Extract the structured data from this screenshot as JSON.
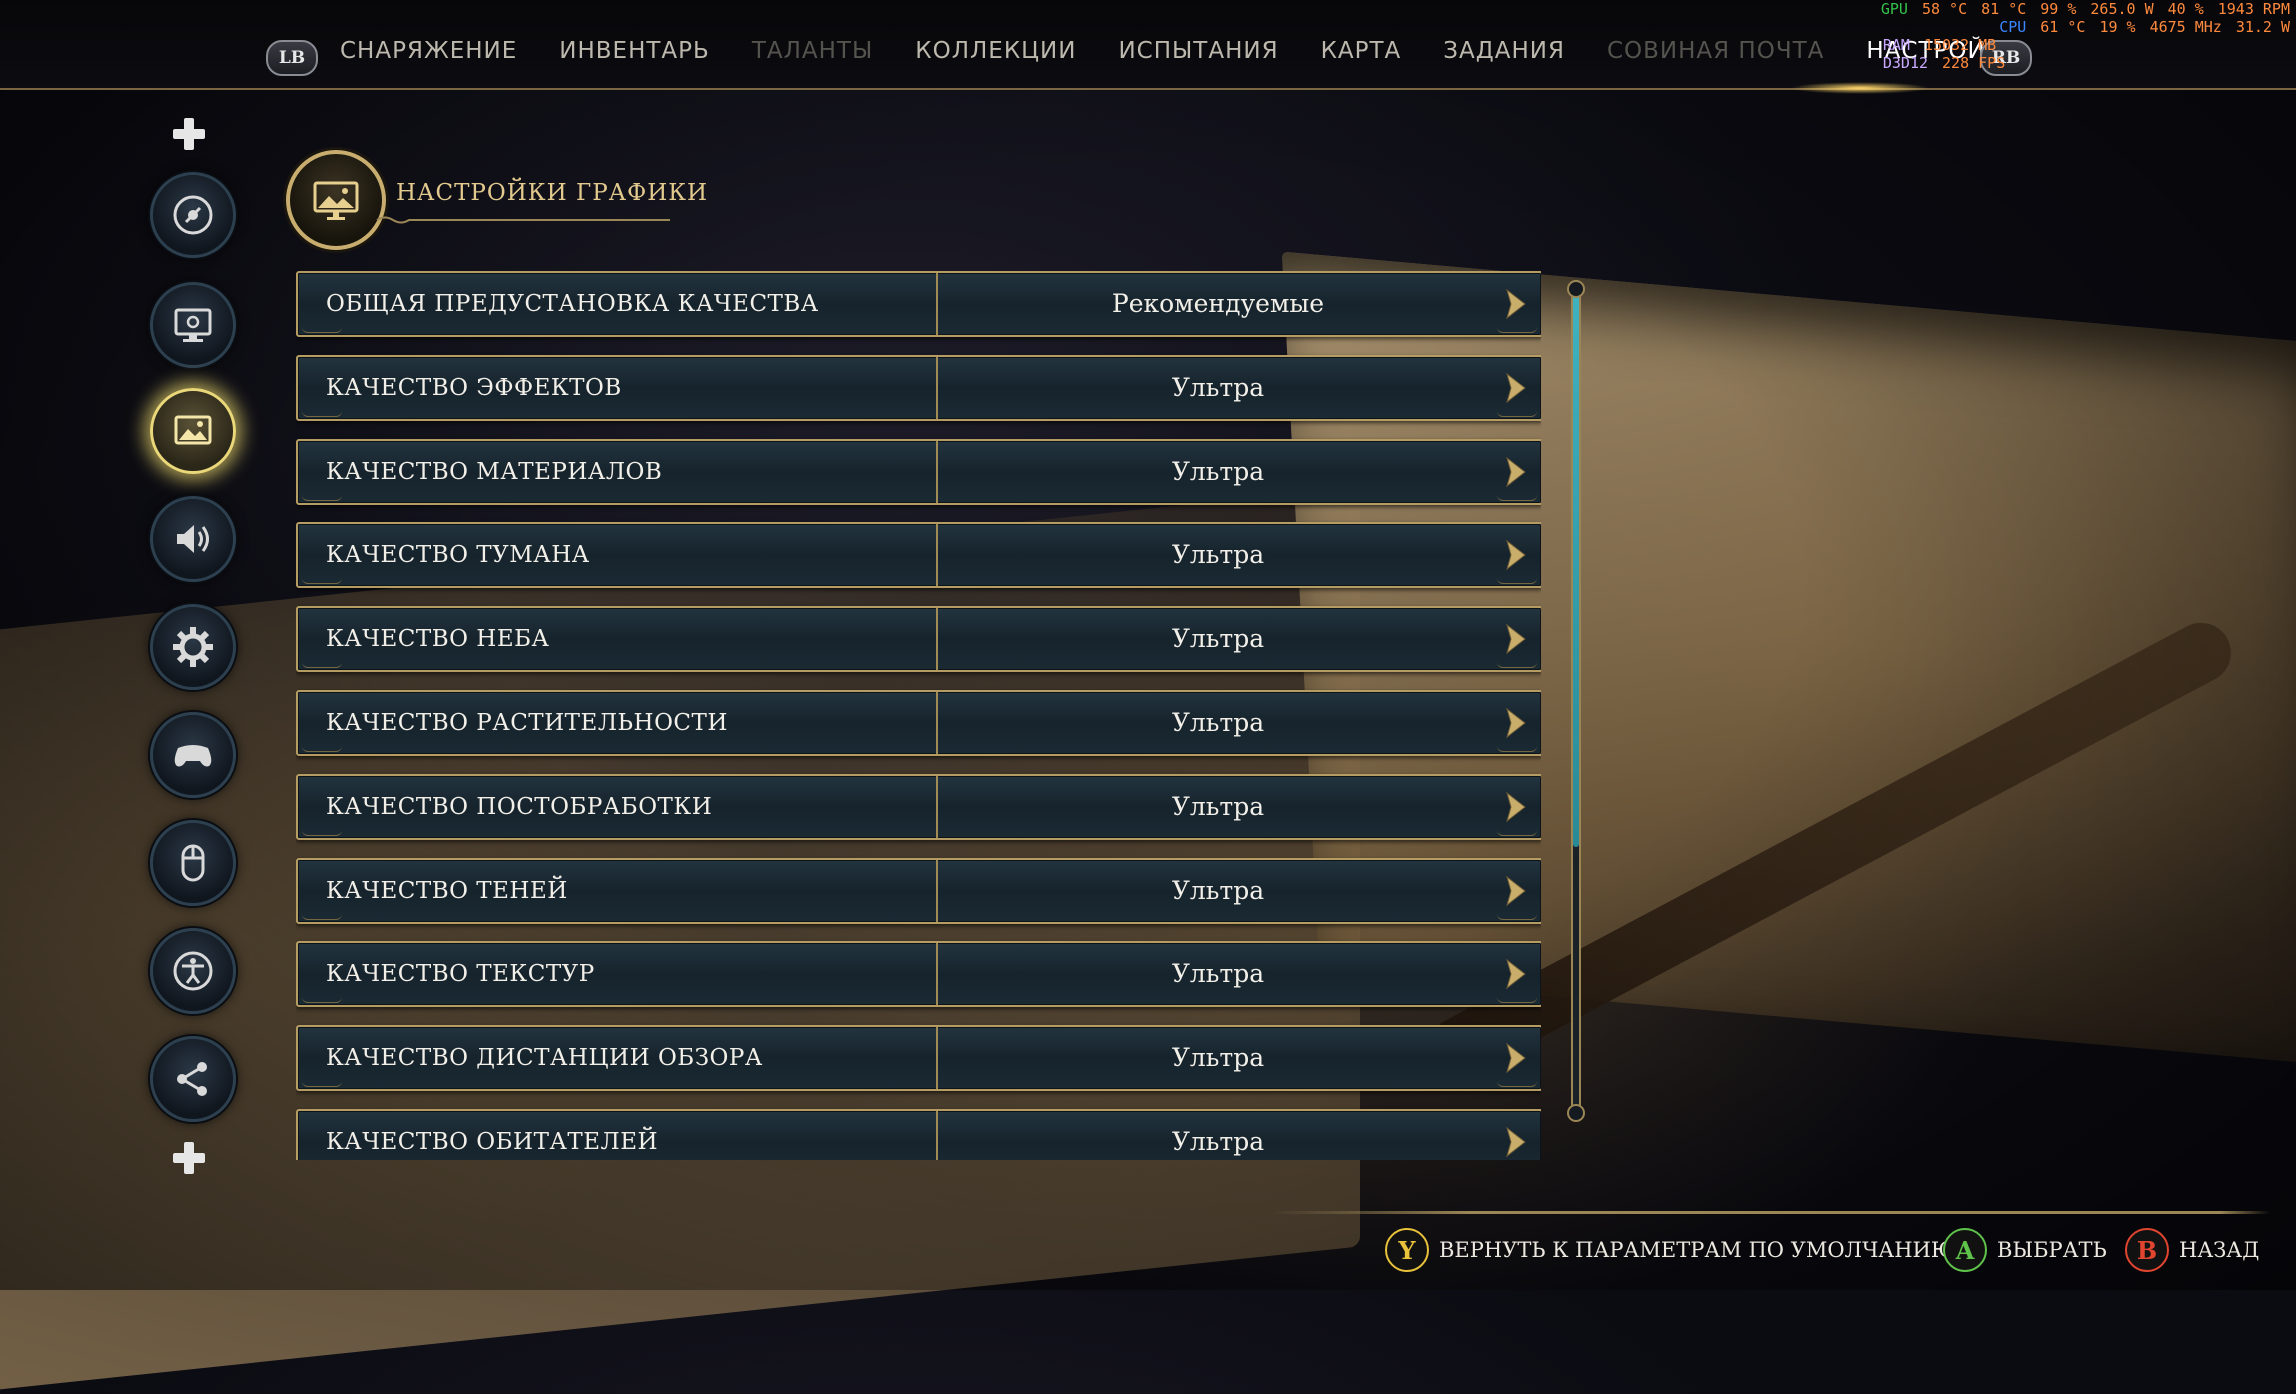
{
  "top_nav": {
    "lb_label": "LB",
    "rb_label": "RB",
    "tabs": [
      {
        "label": "СНАРЯЖЕНИЕ",
        "state": "normal"
      },
      {
        "label": "ИНВЕНТАРЬ",
        "state": "normal"
      },
      {
        "label": "ТАЛАНТЫ",
        "state": "dim"
      },
      {
        "label": "КОЛЛЕКЦИИ",
        "state": "normal"
      },
      {
        "label": "ИСПЫТАНИЯ",
        "state": "normal"
      },
      {
        "label": "КАРТА",
        "state": "normal"
      },
      {
        "label": "ЗАДАНИЯ",
        "state": "normal"
      },
      {
        "label": "СОВИНАЯ ПОЧТА",
        "state": "dim"
      },
      {
        "label": "НАСТРОЙКИ",
        "state": "active"
      }
    ]
  },
  "perf_overlay": {
    "gpu_label": "GPU",
    "gpu_temp": "58 °C",
    "gpu_hotspot": "81 °C",
    "gpu_load": "99 %",
    "gpu_power": "265.0 W",
    "fan": "40 %",
    "fps_right": "1943 RPM",
    "cpu_label": "CPU",
    "cpu_temp": "61 °C",
    "cpu_load": "19 %",
    "cpu_clock": "4675 MHz",
    "cpu_power": "31.2 W",
    "ram_label": "RAM",
    "ram_value": "15032 MB",
    "d3d_label": "D3D12",
    "d3d_value": "228 FPS"
  },
  "sidebar": {
    "items": [
      {
        "name": "disc",
        "icon": "disc-icon",
        "active": false
      },
      {
        "name": "display",
        "icon": "monitor-settings-icon",
        "active": false
      },
      {
        "name": "graphics",
        "icon": "image-icon",
        "active": true
      },
      {
        "name": "audio",
        "icon": "speaker-icon",
        "active": false
      },
      {
        "name": "gameplay",
        "icon": "gear-icon",
        "active": false
      },
      {
        "name": "controller",
        "icon": "gamepad-icon",
        "active": false
      },
      {
        "name": "mouse",
        "icon": "mouse-icon",
        "active": false
      },
      {
        "name": "accessibility",
        "icon": "accessibility-icon",
        "active": false
      },
      {
        "name": "account",
        "icon": "share-icon",
        "active": false
      }
    ]
  },
  "header": {
    "title": "НАСТРОЙКИ ГРАФИКИ",
    "icon": "image-icon"
  },
  "settings": [
    {
      "label": "ОБЩАЯ ПРЕДУСТАНОВКА КАЧЕСТВА",
      "value": "Рекомендуемые"
    },
    {
      "label": "КАЧЕСТВО ЭФФЕКТОВ",
      "value": "Ультра"
    },
    {
      "label": "КАЧЕСТВО МАТЕРИАЛОВ",
      "value": "Ультра"
    },
    {
      "label": "КАЧЕСТВО ТУМАНА",
      "value": "Ультра"
    },
    {
      "label": "КАЧЕСТВО НЕБА",
      "value": "Ультра"
    },
    {
      "label": "КАЧЕСТВО РАСТИТЕЛЬНОСТИ",
      "value": "Ультра"
    },
    {
      "label": "КАЧЕСТВО ПОСТОБРАБОТКИ",
      "value": "Ультра"
    },
    {
      "label": "КАЧЕСТВО ТЕНЕЙ",
      "value": "Ультра"
    },
    {
      "label": "КАЧЕСТВО ТЕКСТУР",
      "value": "Ультра"
    },
    {
      "label": "КАЧЕСТВО ДИСТАНЦИИ ОБЗОРА",
      "value": "Ультра"
    },
    {
      "label": "КАЧЕСТВО ОБИТАТЕЛЕЙ",
      "value": "Ультра"
    }
  ],
  "scroll_fraction_visible": 0.67,
  "hints": {
    "reset": {
      "button": "Y",
      "label": "ВЕРНУТЬ К ПАРАМЕТРАМ ПО УМОЛЧАНИЮ",
      "color": "#e8c23a"
    },
    "select": {
      "button": "A",
      "label": "ВЫБРАТЬ",
      "color": "#5fc24a"
    },
    "back": {
      "button": "B",
      "label": "НАЗАД",
      "color": "#e0452f"
    }
  },
  "colors": {
    "gold": "#b59c63",
    "row_bg": "#1a2a33",
    "accent_glow": "#e9d77a",
    "scroll_accent": "#3fb2c0"
  }
}
